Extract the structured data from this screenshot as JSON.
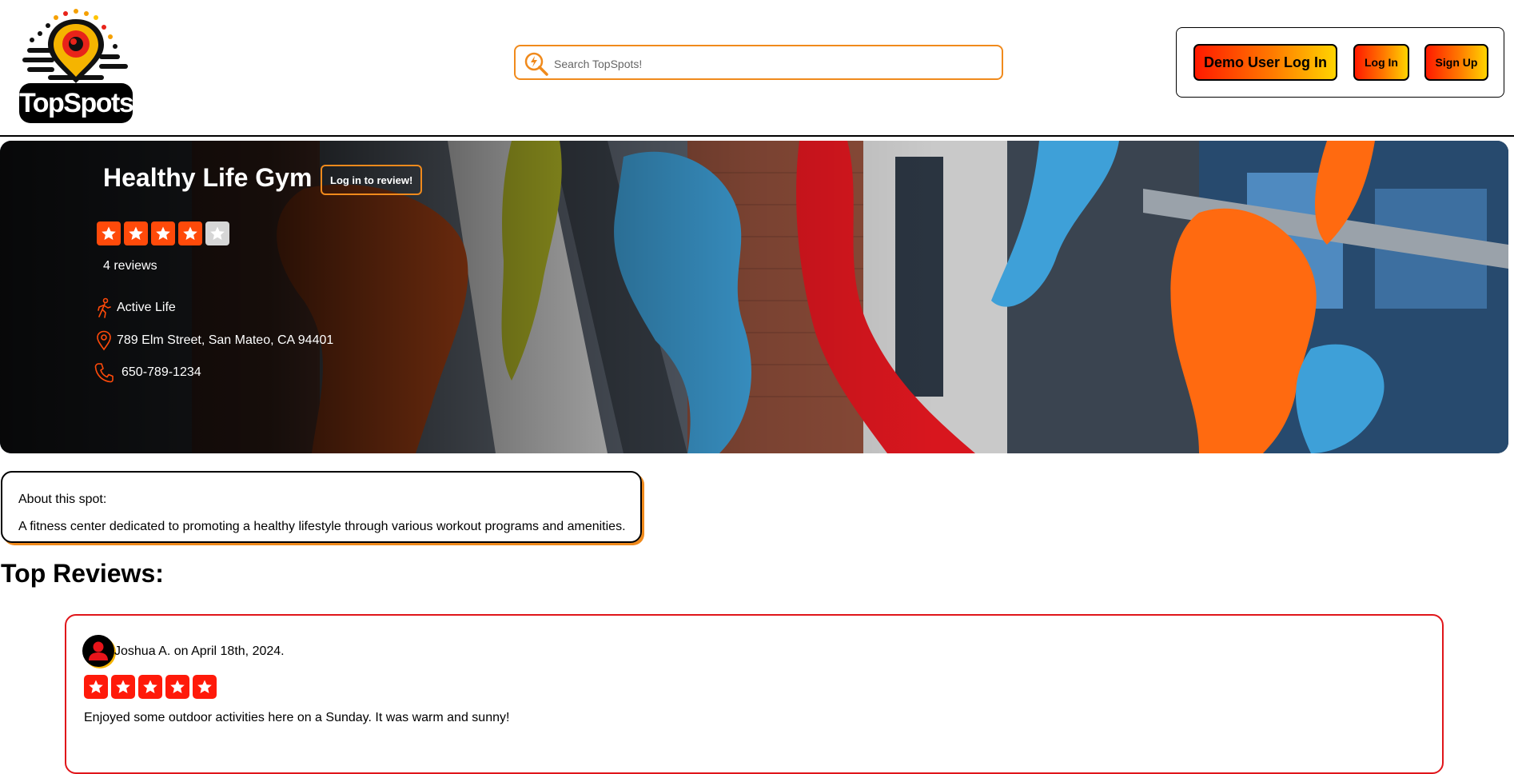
{
  "header": {
    "logo_text": "TopSpots",
    "search": {
      "placeholder": "Search TopSpots!",
      "value": ""
    },
    "auth": {
      "demo_label": "Demo User Log In",
      "login_label": "Log In",
      "signup_label": "Sign Up"
    }
  },
  "spot": {
    "name": "Healthy Life Gym",
    "review_button_label": "Log in to review!",
    "rating": 4,
    "rating_max": 5,
    "review_count_text": "4 reviews",
    "category": "Active Life",
    "address": "789 Elm Street, San Mateo, CA 94401",
    "phone": "650-789-1234"
  },
  "about": {
    "label": "About this spot:",
    "text": "A fitness center dedicated to promoting a healthy lifestyle through various workout programs and amenities."
  },
  "reviews_section": {
    "heading": "Top Reviews:",
    "reviews": [
      {
        "author_line": "Joshua A. on April 18th, 2024.",
        "rating": 5,
        "text": "Enjoyed some outdoor activities here on a Sunday. It was warm and sunny!"
      }
    ]
  },
  "colors": {
    "accent_orange": "#f08a1c",
    "star_orange": "#ff4a0a",
    "review_border_red": "#e0151a"
  },
  "icons": [
    "search-icon",
    "walking-person-icon",
    "map-pin-icon",
    "phone-icon",
    "user-icon",
    "star-icon"
  ]
}
